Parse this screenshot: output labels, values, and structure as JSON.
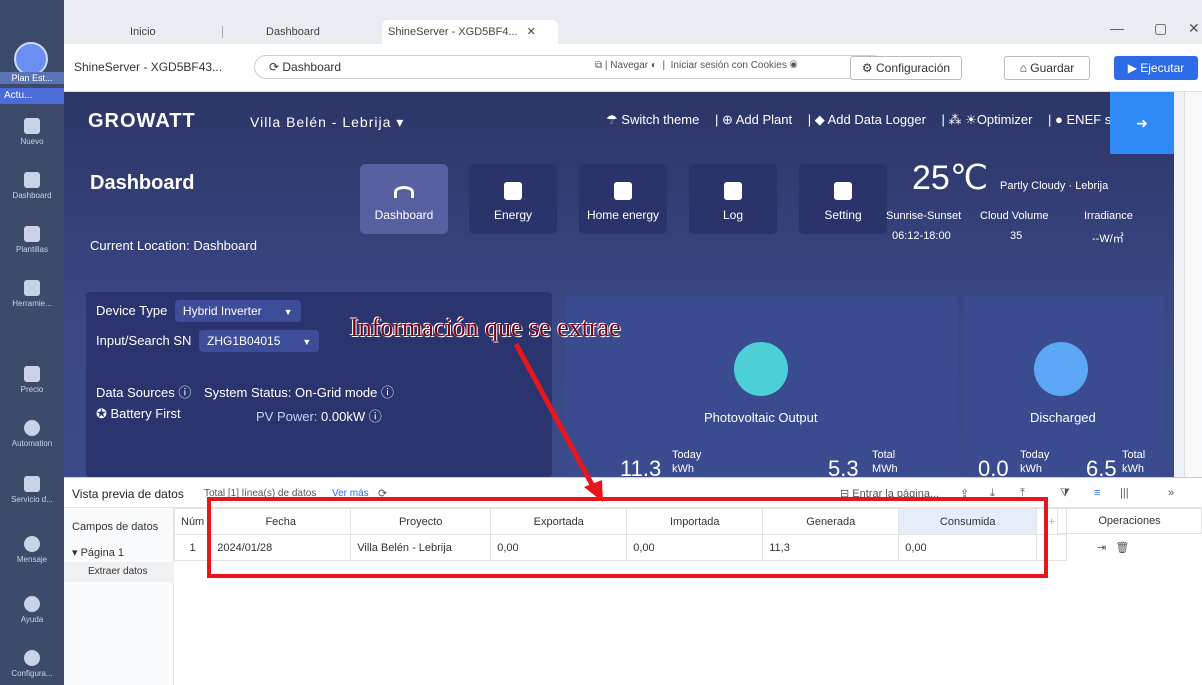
{
  "app_sidebar": {
    "profile_label": "Plan Est...",
    "active_label": "Actu...",
    "items": [
      {
        "label": "Nuevo",
        "icon": "plus-icon"
      },
      {
        "label": "Dashboard",
        "icon": "dashboard-icon"
      },
      {
        "label": "Plantillas",
        "icon": "templates-icon"
      },
      {
        "label": "Herramie...",
        "icon": "toolbox-icon"
      },
      {
        "label": "Precio",
        "icon": "crown-icon"
      },
      {
        "label": "Automation",
        "icon": "robot-icon"
      },
      {
        "label": "Servicio d...",
        "icon": "service-icon"
      },
      {
        "label": "Mensaje",
        "icon": "bell-icon"
      },
      {
        "label": "Ayuda",
        "icon": "help-icon"
      },
      {
        "label": "Configura...",
        "icon": "gear-icon"
      }
    ]
  },
  "tabs": [
    "Inicio",
    "Dashboard",
    "ShineServer - XGD5BF4..."
  ],
  "tab_close": "✕",
  "window_controls": {
    "minimize": "—",
    "maximize": "▢",
    "close": "✕"
  },
  "toolbar": {
    "title": "ShineServer - XGD5BF43...",
    "url": "Dashboard",
    "navigate_label": "Navegar",
    "cookies_label": "Iniciar sesión con Cookies",
    "config_label": "Configuración",
    "save_label": "Guardar",
    "run_label": "Ejecutar"
  },
  "growatt": {
    "brand": "GROWATT",
    "plant": "Villa Belén - Lebrija ▾",
    "links": [
      "Switch theme",
      "Add Plant",
      "Add Data Logger",
      "Optimizer",
      "ENEF sas"
    ],
    "dashboard_title": "Dashboard",
    "current_location": "Current Location: Dashboard",
    "nav": [
      "Dashboard",
      "Energy",
      "Home energy",
      "Log",
      "Setting"
    ],
    "weather": {
      "temp": "25℃",
      "desc": "Partly Cloudy · Lebrija",
      "labels": [
        "Sunrise-Sunset",
        "Cloud Volume",
        "Irradiance"
      ],
      "values": [
        "06:12-18:00",
        "35",
        "--W/㎡"
      ]
    },
    "device": {
      "type_label": "Device Type",
      "type_value": "Hybrid Inverter",
      "sn_label": "Input/Search SN",
      "sn_value": "ZHG1B04015",
      "data_sources": "Data Sources ⓘ",
      "system_status": "System Status: On-Grid mode ⓘ",
      "battery_mode": "Battery First",
      "pv_power_label": "PV Power:",
      "pv_power_value": "0.00kW ⓘ"
    },
    "pv_output": {
      "title": "Photovoltaic Output",
      "today_value": "11.3",
      "today_label": "Today",
      "today_unit": "kWh",
      "total_value": "5.3",
      "total_label": "Total",
      "total_unit": "MWh"
    },
    "discharged": {
      "title": "Discharged",
      "today_value": "0.0",
      "today_label": "Today",
      "today_unit": "kWh",
      "total_value": "6.5",
      "total_label": "Total",
      "total_unit": "kWh"
    }
  },
  "annotation": {
    "text": "Información que se extrae",
    "color": "#e8161b"
  },
  "preview": {
    "title": "Vista previa de datos",
    "total": "Total [1] línea(s) de datos",
    "more": "Ver más",
    "goto_page": "Entrar la página...",
    "fields_header": "Campos de datos",
    "page_item": "▾ Página 1",
    "extract_item": "Extraer datos",
    "columns": [
      "Núm",
      "Fecha",
      "Proyecto",
      "Exportada",
      "Importada",
      "Generada",
      "Consumida"
    ],
    "ops_header": "Operaciones",
    "rows": [
      {
        "num": "1",
        "fecha": "2024/01/28",
        "proyecto": "Villa Belén - Lebrija",
        "exportada": "0,00",
        "importada": "0,00",
        "generada": "11,3",
        "consumida": "0,00"
      }
    ]
  }
}
